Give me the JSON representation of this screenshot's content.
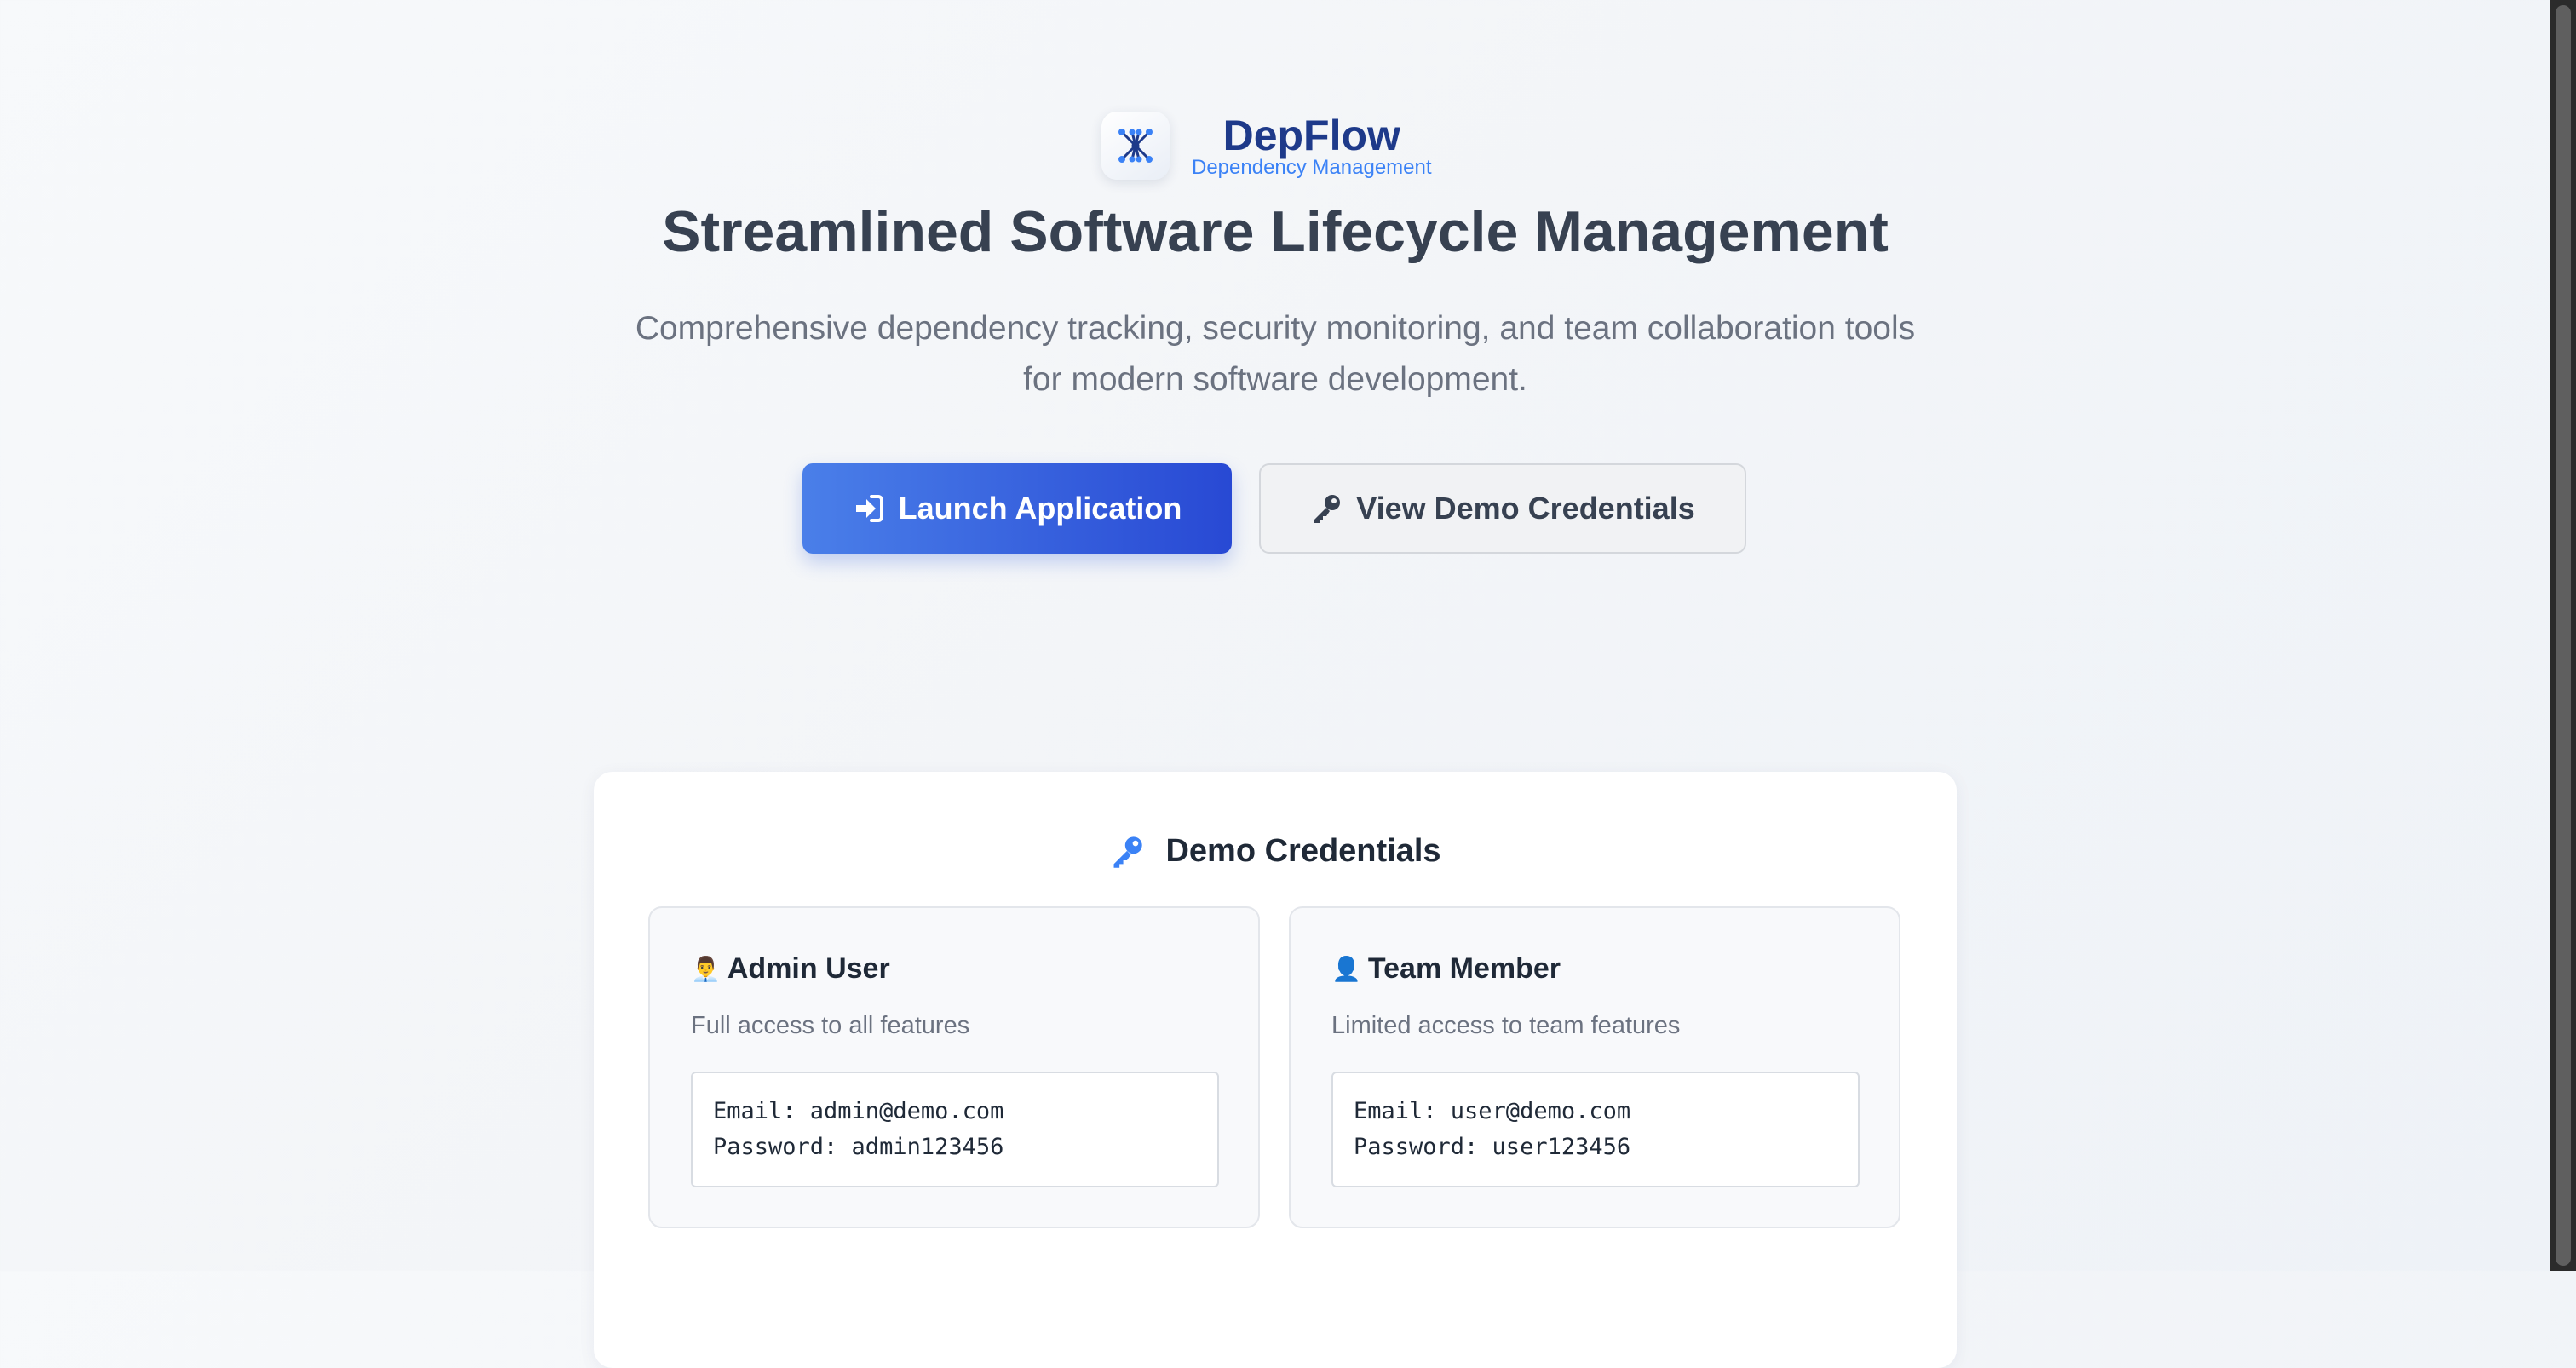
{
  "brand": {
    "name": "DepFlow",
    "tagline": "Dependency Management",
    "logo_icon": "network-graph-icon"
  },
  "hero": {
    "title": "Streamlined Software Lifecycle Management",
    "subtitle_line1": "Comprehensive dependency tracking, security monitoring, and team collaboration tools",
    "subtitle_line2": "for modern software development."
  },
  "actions": {
    "launch_label": "Launch Application",
    "launch_icon": "sign-in-icon",
    "demo_label": "View Demo Credentials",
    "demo_icon": "key-icon"
  },
  "credentials": {
    "title": "Demo Credentials",
    "title_icon": "key-icon",
    "admin": {
      "emoji": "👨‍💼",
      "name": "Admin User",
      "description": "Full access to all features",
      "email_line": "Email: admin@demo.com",
      "password_line": "Password: admin123456"
    },
    "member": {
      "emoji": "👤",
      "name": "Team Member",
      "description": "Limited access to team features",
      "email_line": "Email: user@demo.com",
      "password_line": "Password: user123456"
    }
  },
  "colors": {
    "primary": "#2849d4",
    "brand_text": "#1e3a8a",
    "accent": "#3b82f6"
  }
}
